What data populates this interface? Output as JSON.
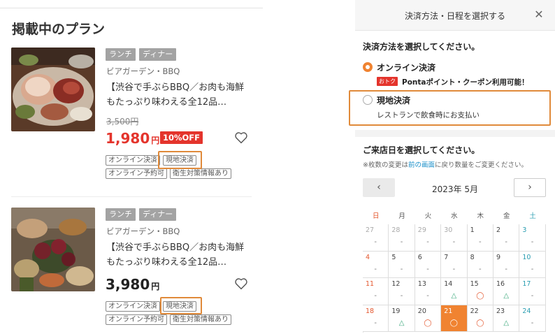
{
  "left": {
    "title": "掲載中のプラン",
    "plans": [
      {
        "tags": [
          "ランチ",
          "ディナー"
        ],
        "category": "ビアガーデン・BBQ",
        "title_line1": "【渋谷で手ぶらBBQ／お肉も海鮮",
        "title_line2": "もたっぷり味わえる全12品…",
        "old_price": "3,500円",
        "price": "1,980",
        "price_unit": "円",
        "discount": "10%OFF",
        "labels_row1": [
          "オンライン決済",
          "現地決済"
        ],
        "labels_row2": [
          "オンライン予約可",
          "衛生対策情報あり"
        ]
      },
      {
        "tags": [
          "ランチ",
          "ディナー"
        ],
        "category": "ビアガーデン・BBQ",
        "title_line1": "【渋谷で手ぶらBBQ／お肉も海鮮",
        "title_line2": "もたっぷり味わえる全12品…",
        "price": "3,980",
        "price_unit": "円",
        "labels_row1": [
          "オンライン決済",
          "現地決済"
        ],
        "labels_row2": [
          "オンライン予約可",
          "衛生対策情報あり"
        ]
      }
    ]
  },
  "modal": {
    "title": "決済方法・日程を選択する",
    "close_icon": "close-icon",
    "payment_heading": "決済方法を選択してください。",
    "online_label": "オンライン決済",
    "otoku_badge": "おトク",
    "ponta_text": "Pontaポイント・クーポン利用可能！",
    "onsite_label": "現地決済",
    "onsite_sub": "レストランで飲食時にお支払い",
    "date_heading": "ご来店日を選択してください。",
    "note_prefix": "※枚数の変更は",
    "note_link": "前の画面",
    "note_suffix": "に戻り数量をご変更ください。",
    "prev_label": "‹",
    "next_label": "›",
    "month_label": "2023年 5月",
    "weekdays": [
      "日",
      "月",
      "火",
      "水",
      "木",
      "金",
      "土"
    ],
    "weekday_colors": [
      "#e4572e",
      "#555555",
      "#555555",
      "#555555",
      "#555555",
      "#555555",
      "#2a9db1"
    ],
    "weeks": [
      [
        {
          "d": "27",
          "m": "-",
          "past": true
        },
        {
          "d": "28",
          "m": "-",
          "past": true
        },
        {
          "d": "29",
          "m": "-",
          "past": true
        },
        {
          "d": "30",
          "m": "-",
          "past": true
        },
        {
          "d": "1",
          "m": "-"
        },
        {
          "d": "2",
          "m": "-"
        },
        {
          "d": "3",
          "m": "-"
        }
      ],
      [
        {
          "d": "4",
          "m": "-"
        },
        {
          "d": "5",
          "m": "-"
        },
        {
          "d": "6",
          "m": "-"
        },
        {
          "d": "7",
          "m": "-"
        },
        {
          "d": "8",
          "m": "-"
        },
        {
          "d": "9",
          "m": "-"
        },
        {
          "d": "10",
          "m": "-"
        }
      ],
      [
        {
          "d": "11",
          "m": "-"
        },
        {
          "d": "12",
          "m": "-"
        },
        {
          "d": "13",
          "m": "-"
        },
        {
          "d": "14",
          "m": "△"
        },
        {
          "d": "15",
          "m": "◯"
        },
        {
          "d": "16",
          "m": "△"
        },
        {
          "d": "17",
          "m": "-"
        }
      ],
      [
        {
          "d": "18",
          "m": "-"
        },
        {
          "d": "19",
          "m": "△"
        },
        {
          "d": "20",
          "m": "◯"
        },
        {
          "d": "21",
          "m": "◯",
          "selected": true
        },
        {
          "d": "22",
          "m": "◯"
        },
        {
          "d": "23",
          "m": "△"
        },
        {
          "d": "24",
          "m": "-"
        }
      ]
    ]
  },
  "colors": {
    "accent": "#f08331",
    "price_red": "#e4342c",
    "highlight_border": "#e08a3a",
    "link": "#1a8fc9"
  }
}
